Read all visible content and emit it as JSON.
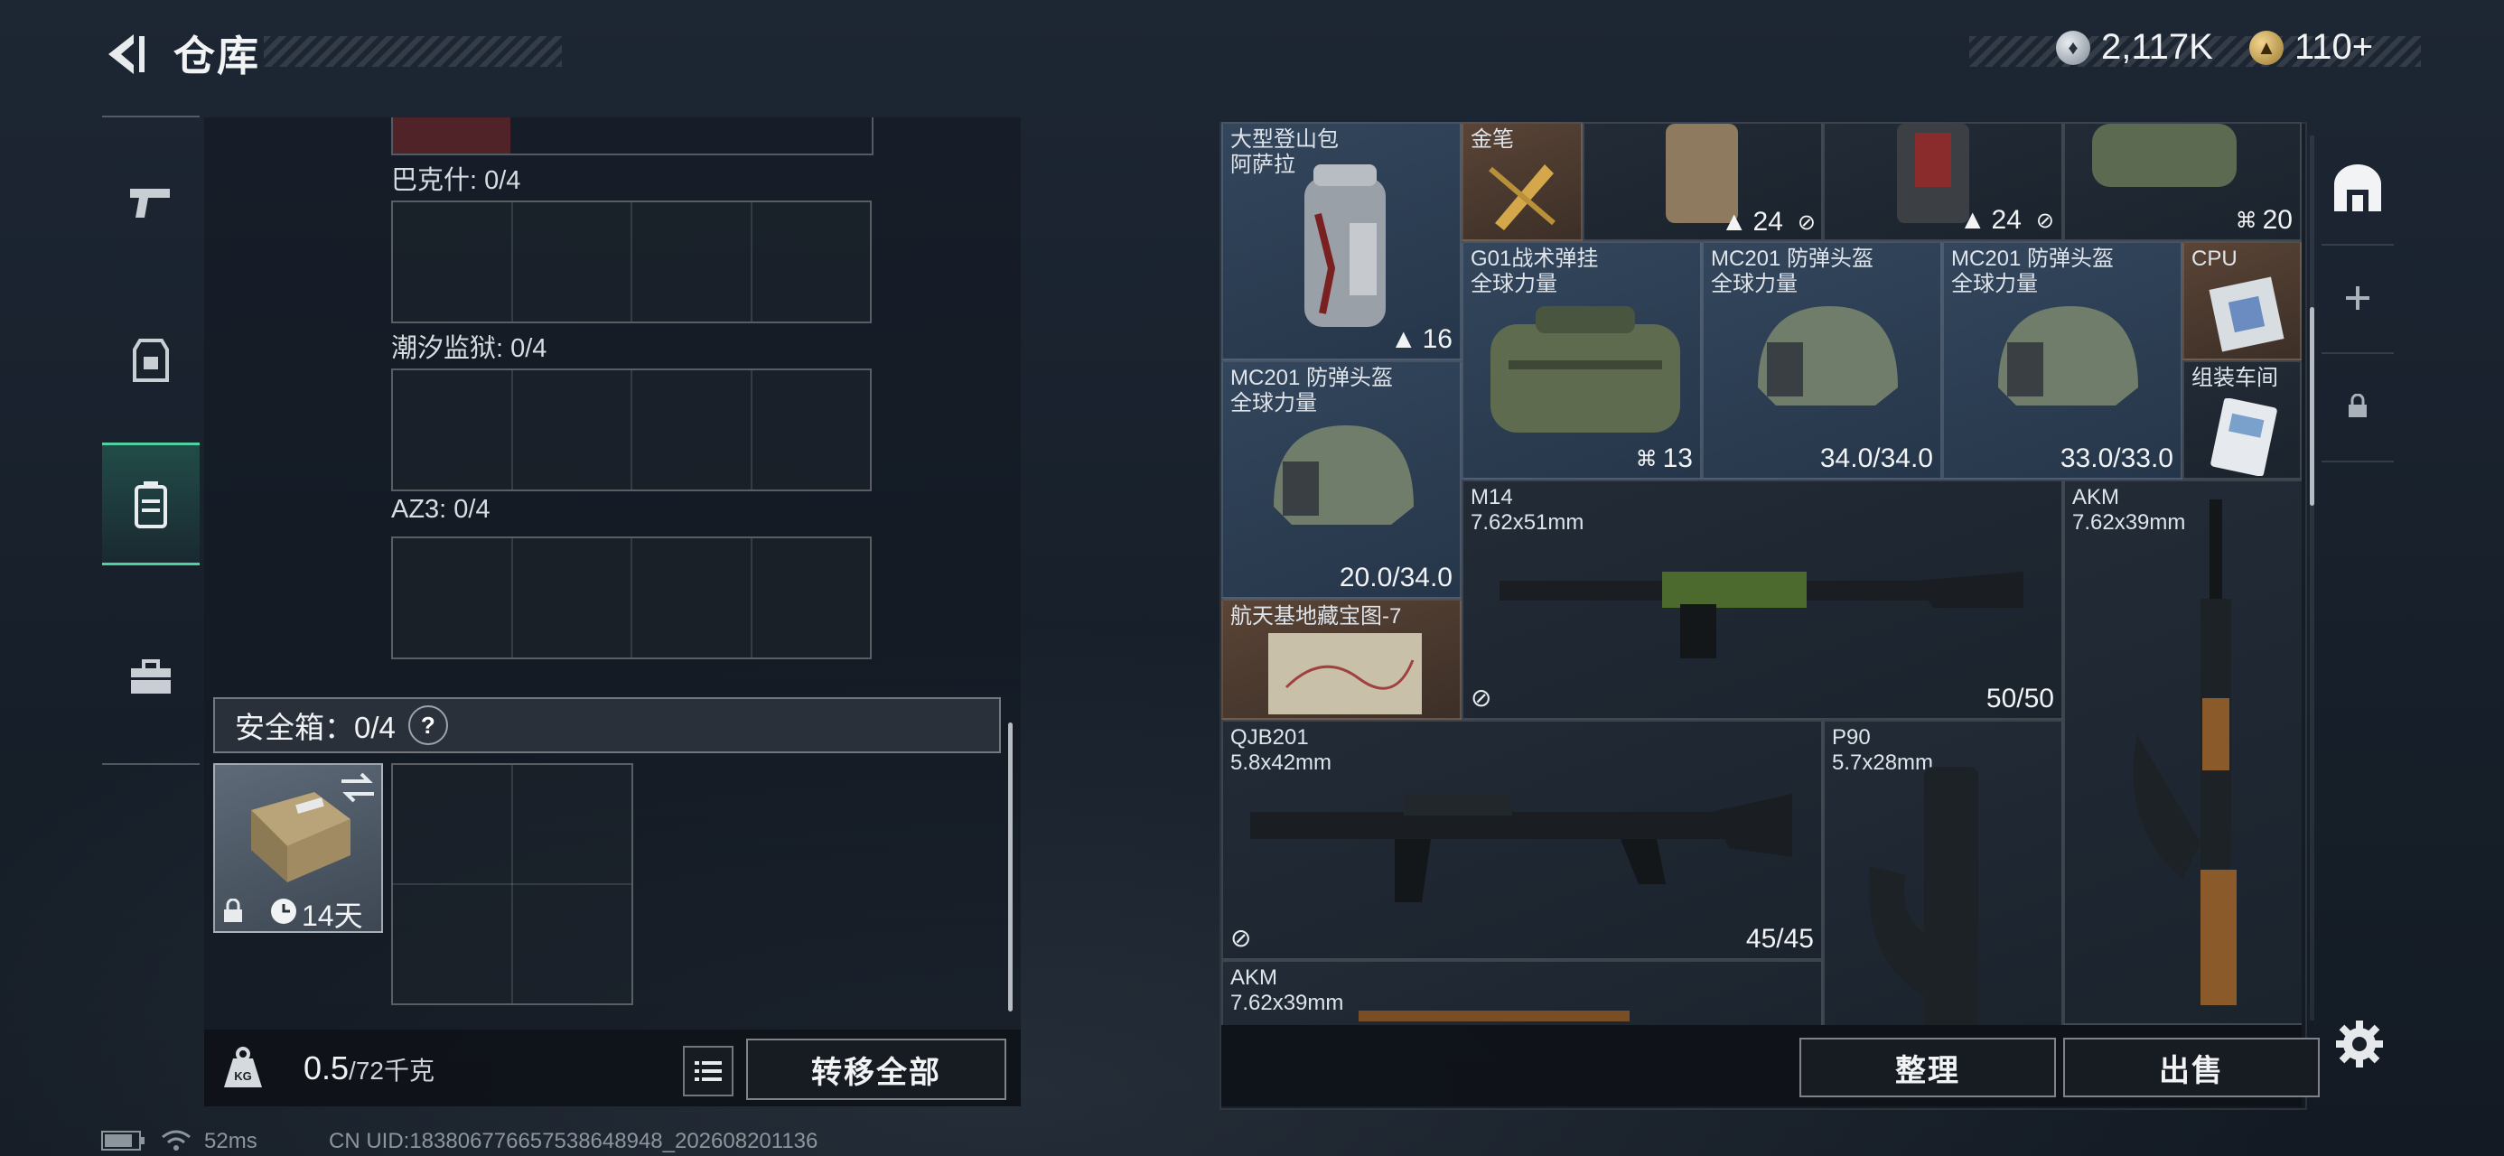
{
  "header": {
    "title": "仓库",
    "currency_silver": "2,117K",
    "currency_gold": "110+",
    "icons": [
      "back-arrow-icon",
      "silver-coin-icon",
      "gold-coin-icon"
    ]
  },
  "left_nav": {
    "items": [
      {
        "name": "weapons",
        "icon": "pistol-icon"
      },
      {
        "name": "armor",
        "icon": "vest-icon"
      },
      {
        "name": "backpack",
        "icon": "backpack-icon",
        "active": true
      },
      {
        "name": "items",
        "icon": "briefcase-icon"
      }
    ],
    "active_color": "#4fd2a0"
  },
  "stash": {
    "sections": [
      {
        "label": "巴克什: 0/4"
      },
      {
        "label": "潮汐监狱: 0/4"
      },
      {
        "label": "AZ3: 0/4"
      }
    ],
    "safebox": {
      "title": "安全箱：0/4",
      "help": "?",
      "duration": "14天"
    },
    "weight_value": "0.5",
    "weight_max": "/72千克",
    "weight_icon": "KG",
    "transfer_all": "转移全部"
  },
  "inventory": {
    "items": [
      {
        "id": "backpack",
        "name": "大型登山包\n阿萨拉",
        "value": "16"
      },
      {
        "id": "goldpen",
        "name": "金笔",
        "value": ""
      },
      {
        "id": "vest1",
        "name": "",
        "value": ""
      },
      {
        "id": "vest2",
        "name": "",
        "value": "24"
      },
      {
        "id": "vest3",
        "name": "",
        "value": "24"
      },
      {
        "id": "bag1",
        "name": "",
        "value": "20"
      },
      {
        "id": "g01",
        "name": "G01战术弹挂\n全球力量",
        "value": "13"
      },
      {
        "id": "helmet1",
        "name": "MC201 防弹头盔\n全球力量",
        "value": "34.0/34.0"
      },
      {
        "id": "helmet2",
        "name": "MC201 防弹头盔\n全球力量",
        "value": "33.0/33.0"
      },
      {
        "id": "cpu",
        "name": "CPU",
        "value": ""
      },
      {
        "id": "workshop",
        "name": "组装车间",
        "value": ""
      },
      {
        "id": "helmet3",
        "name": "MC201 防弹头盔\n全球力量",
        "value": "20.0/34.0"
      },
      {
        "id": "m14",
        "name": "M14\n7.62x51mm",
        "value": "50/50"
      },
      {
        "id": "akm1",
        "name": "AKM\n7.62x39mm",
        "value": ""
      },
      {
        "id": "map",
        "name": "航天基地藏宝图-7",
        "value": ""
      },
      {
        "id": "qjb",
        "name": "QJB201\n5.8x42mm",
        "value": "45/45"
      },
      {
        "id": "p90",
        "name": "P90\n5.7x28mm",
        "value": ""
      },
      {
        "id": "akm2",
        "name": "AKM\n7.62x39mm",
        "value": ""
      }
    ],
    "sort_btn": "整理",
    "sell_btn": "出售"
  },
  "right_tools": [
    "vault-icon",
    "plus-icon",
    "lock-icon"
  ],
  "status": {
    "ping": "52ms",
    "uid": "CN UID:18380677665753864894​8_202608201136"
  }
}
